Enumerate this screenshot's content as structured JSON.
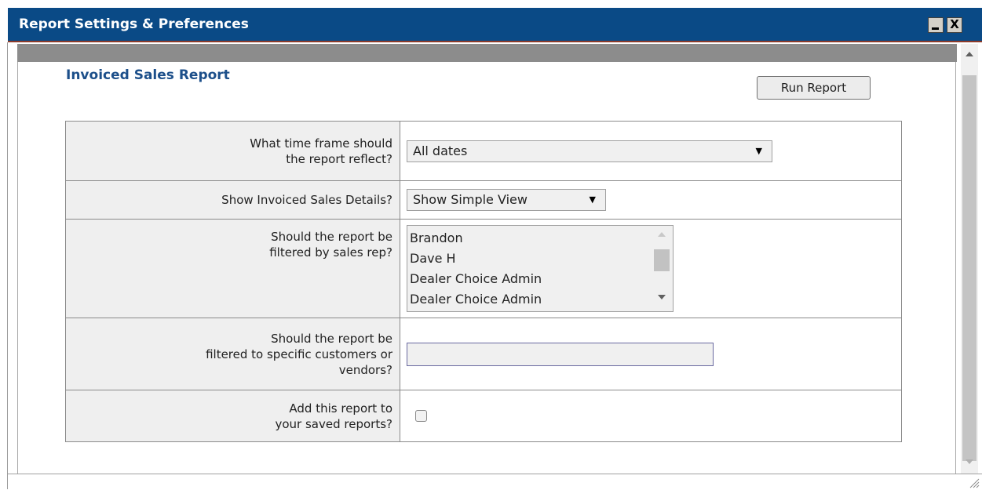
{
  "window": {
    "title": "Report Settings & Preferences",
    "minimize_glyph": "_",
    "close_glyph": "X"
  },
  "report": {
    "title": "Invoiced Sales Report",
    "run_button_label": "Run Report"
  },
  "form": {
    "time_frame": {
      "label_line1": "What time frame should",
      "label_line2": "the report reflect?",
      "selected": "All dates"
    },
    "details": {
      "label": "Show Invoiced Sales Details?",
      "selected": "Show Simple View"
    },
    "sales_rep": {
      "label_line1": "Should the report be",
      "label_line2": "filtered by sales rep?",
      "options": [
        "Brandon",
        "Dave H",
        "Dealer Choice Admin",
        "Dealer Choice Admin"
      ]
    },
    "customers": {
      "label_line1": "Should the report be",
      "label_line2": "filtered to specific customers or",
      "label_line3": "vendors?",
      "value": ""
    },
    "save": {
      "label_line1": "Add this report to",
      "label_line2": "your saved reports?",
      "checked": false
    }
  },
  "icons": {
    "dropdown_arrow": "▼",
    "scroll_up": "chevron-up-icon",
    "scroll_down": "chevron-down-icon",
    "resize_grip": "resize-grip-icon"
  },
  "colors": {
    "titlebar": "#0a4a86",
    "report_title": "#1c4f8a",
    "graybar": "#8c8c8c",
    "label_bg": "#efefef"
  }
}
